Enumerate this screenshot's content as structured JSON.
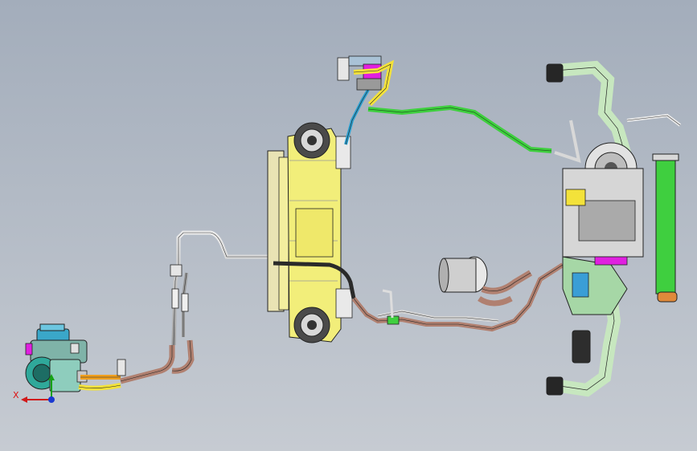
{
  "viewport": {
    "background_top": "#a3adbb",
    "background_bottom": "#c6cbd2"
  },
  "triad": {
    "x_label": "X",
    "x_color": "#d11a1a",
    "y_color": "#16a216",
    "z_color": "#1a3ad1"
  },
  "colors": {
    "yellow_body": "#f2ee7a",
    "green_pipe": "#3fcf3f",
    "copper_pipe": "#b08070",
    "grey_pipe": "#d8d8d8",
    "magenta": "#e020e0",
    "teal": "#2fa89a",
    "line": "#222222"
  }
}
